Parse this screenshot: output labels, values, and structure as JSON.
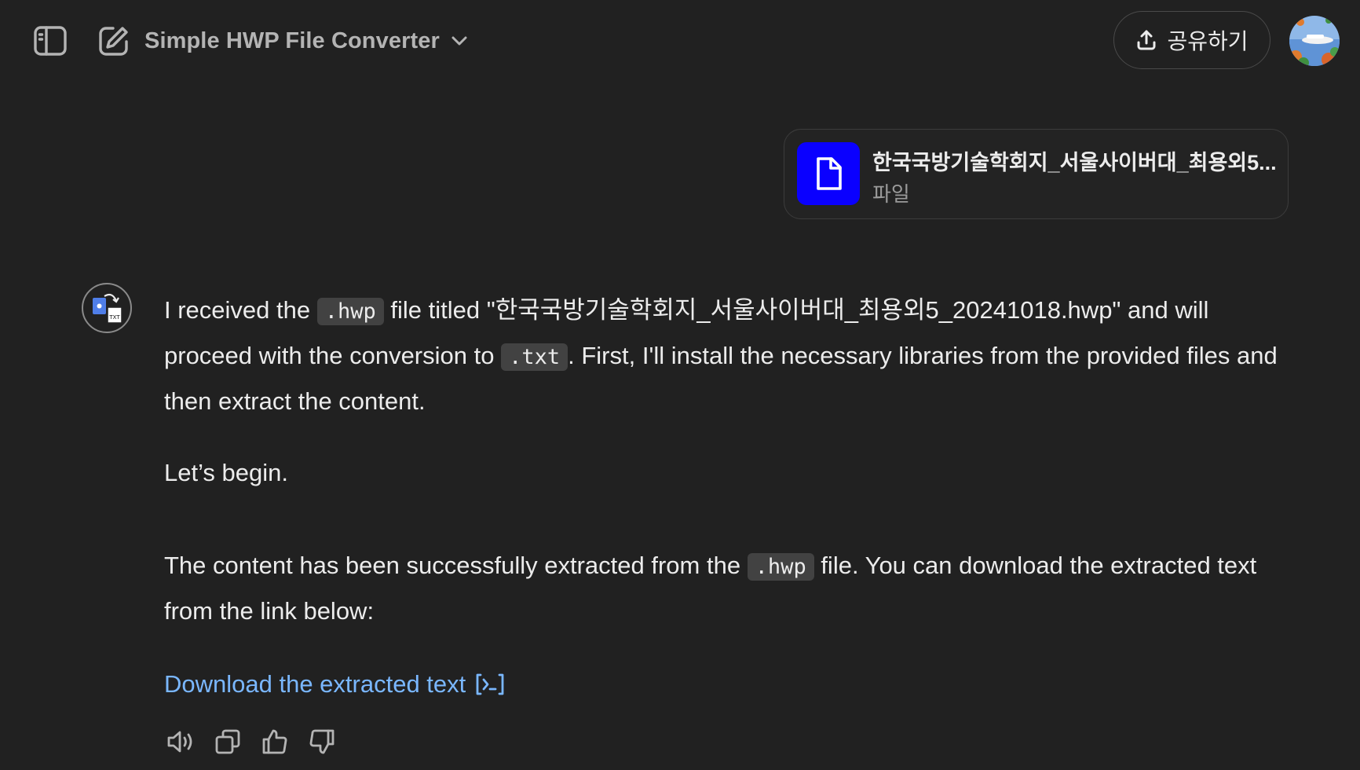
{
  "header": {
    "title": "Simple HWP File Converter",
    "share_label": "공유하기"
  },
  "attachment": {
    "file_name": "한국국방기술학회지_서울사이버대_최용외5...",
    "file_type": "파일"
  },
  "message": {
    "p1_a": "I received the ",
    "p1_code1": ".hwp",
    "p1_b": " file titled \"한국국방기술학회지_서울사이버대_최용외5_20241018.hwp\" and will proceed with the conversion to ",
    "p1_code2": ".txt",
    "p1_c": ". First, I'll install the necessary libraries from the provided files and then extract the content.",
    "p2": "Let’s begin.",
    "p3_a": "The content has been successfully extracted from the ",
    "p3_code": ".hwp",
    "p3_b": " file. You can download the extracted text from the link below:",
    "link_label": "Download the extracted text"
  },
  "icons": {
    "sidebar": "sidebar-toggle-icon",
    "new_chat": "edit-pencil-icon",
    "chevron": "chevron-down-icon",
    "share": "upload-icon",
    "file": "document-icon",
    "code_interpreter": "code-interpreter-icon",
    "read_aloud": "speaker-icon",
    "copy": "copy-icon",
    "thumbs_up": "thumbs-up-icon",
    "thumbs_down": "thumbs-down-icon"
  },
  "colors": {
    "background": "#212121",
    "file_icon_bg": "#0a00ff",
    "link": "#7ab7ff"
  }
}
